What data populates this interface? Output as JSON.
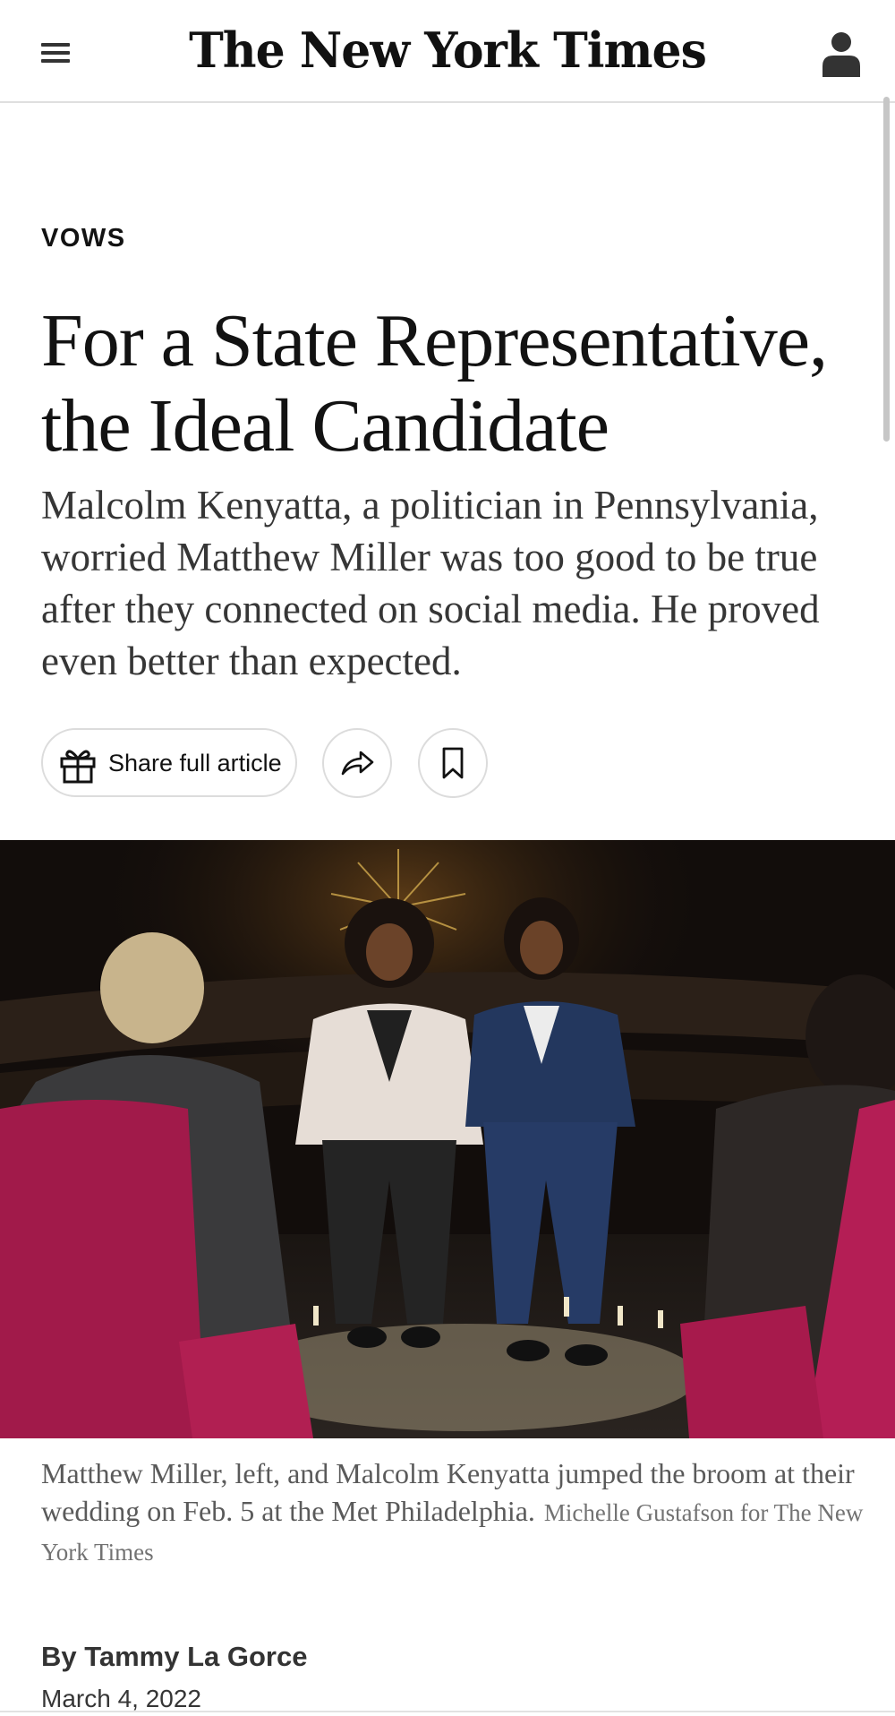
{
  "header": {
    "logo": "The New York Times",
    "menu_icon": "hamburger-menu-icon",
    "account_icon": "person-icon"
  },
  "article": {
    "kicker": "VOWS",
    "headline": "For a State Representative, the Ideal Candidate",
    "summary": "Malcolm Kenyatta, a politician in Pennsylvania, worried Matthew Miller was too good to be true after they connected on social media. He proved even better than expected.",
    "share_label": "Share full article",
    "share_icon": "gift-icon",
    "forward_icon": "share-arrow-icon",
    "bookmark_icon": "bookmark-icon",
    "caption": "Matthew Miller, left, and Malcolm Kenyatta jumped the broom at their wedding on Feb. 5 at the Met Philadelphia.",
    "credit": "Michelle Gustafson for The New York Times",
    "byline": "By Tammy La Gorce",
    "date": "March 4, 2022"
  },
  "colors": {
    "text": "#121212",
    "summary_text": "#363636",
    "caption_text": "#5a5a5a",
    "border": "#dcdcdc"
  }
}
